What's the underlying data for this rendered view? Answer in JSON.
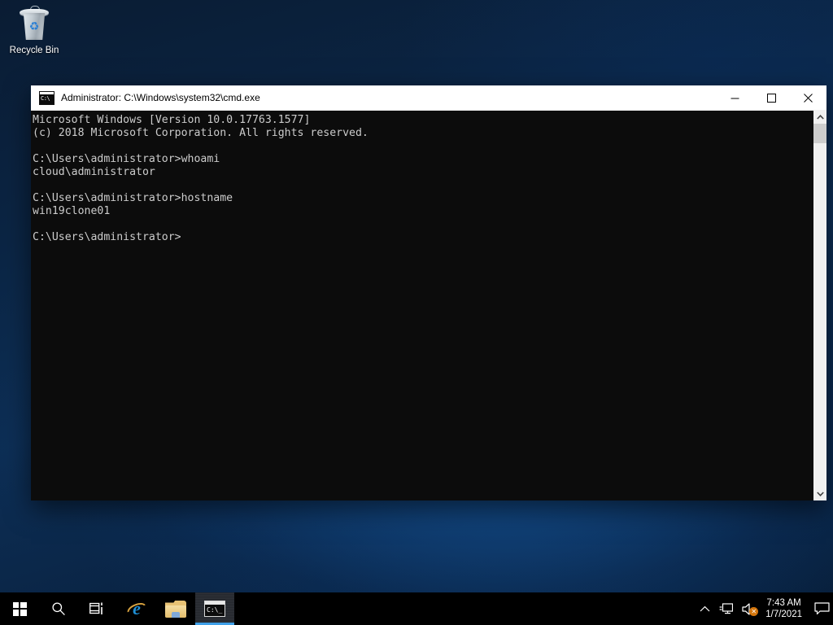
{
  "desktop": {
    "icons": [
      {
        "label": "Recycle Bin",
        "icon": "recycle-bin-icon"
      }
    ]
  },
  "window": {
    "title": "Administrator: C:\\Windows\\system32\\cmd.exe",
    "icon": "cmd-icon",
    "controls": {
      "minimize": "—",
      "maximize": "☐",
      "close": "✕"
    },
    "console_text": "Microsoft Windows [Version 10.0.17763.1577]\n(c) 2018 Microsoft Corporation. All rights reserved.\n\nC:\\Users\\administrator>whoami\ncloud\\administrator\n\nC:\\Users\\administrator>hostname\nwin19clone01\n\nC:\\Users\\administrator>",
    "scrollbar": {
      "up_arrow": "▲",
      "down_arrow": "▼"
    }
  },
  "taskbar": {
    "start": {
      "label": "Start",
      "icon": "windows-logo-icon"
    },
    "search": {
      "label": "Search",
      "icon": "search-icon"
    },
    "task_view": {
      "label": "Task View",
      "icon": "task-view-icon"
    },
    "apps": [
      {
        "label": "Internet Explorer",
        "icon": "internet-explorer-icon",
        "active": false,
        "glyph": "e"
      },
      {
        "label": "File Explorer",
        "icon": "file-explorer-icon",
        "active": false
      },
      {
        "label": "Administrator: C:\\Windows\\system32\\cmd.exe",
        "icon": "cmd-icon",
        "active": true
      }
    ],
    "tray": {
      "show_hidden_icons": {
        "icon": "chevron-up-icon",
        "glyph": "∧"
      },
      "network": {
        "icon": "network-icon"
      },
      "volume": {
        "icon": "speaker-muted-icon",
        "mute_badge": "✕"
      },
      "clock": {
        "time": "7:43 AM",
        "date": "1/7/2021"
      },
      "notifications": {
        "icon": "action-center-icon"
      }
    }
  },
  "colors": {
    "desktop_gradient_top": "#0a1c33",
    "desktop_gradient_mid": "#0d2f56",
    "taskbar_bg": "#000000",
    "console_bg": "#0c0c0c",
    "console_fg": "#cccccc",
    "titlebar_bg": "#ffffff",
    "active_app_underline": "#3fa0e8",
    "mute_badge": "#d4760d"
  }
}
